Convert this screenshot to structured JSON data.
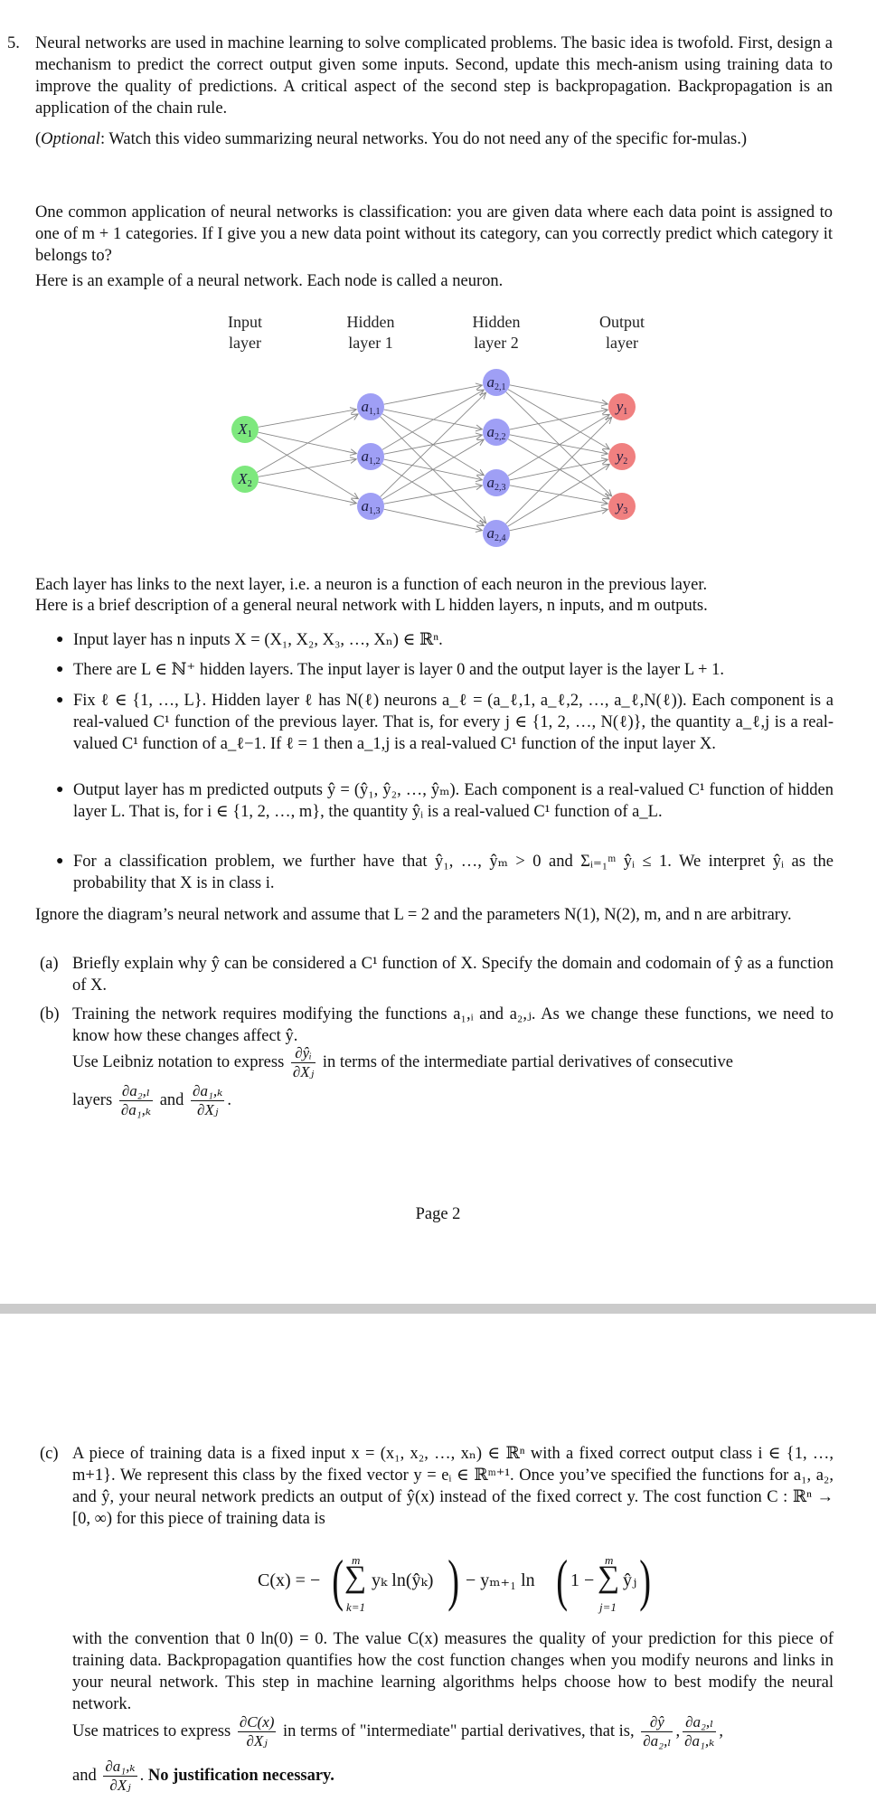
{
  "problem": {
    "number": "5.",
    "intro": "Neural networks are used in machine learning to solve complicated problems. The basic idea is twofold. First, design a mechanism to predict the correct output given some inputs. Second, update this mech-anism using training data to improve the quality of predictions. A critical aspect of the second step is backpropagation. Backpropagation is an application of the chain rule.",
    "optional_label": "Optional",
    "optional_text": ": Watch this video summarizing neural networks. You do not need any of the specific for-mulas.)",
    "classification_text": "One common application of neural networks is classification: you are given data where each data point is assigned to one of m + 1 categories. If I give you a new data point without its category, can you correctly predict which category it belongs to?",
    "example_text": "Here is an example of a neural network. Each node is called a neuron."
  },
  "diagram": {
    "layers": [
      {
        "title1": "Input",
        "title2": "layer",
        "nodes": [
          "X1",
          "X2"
        ],
        "color": "#7ee87e"
      },
      {
        "title1": "Hidden",
        "title2": "layer 1",
        "nodes": [
          "a1,1",
          "a1,2",
          "a1,3"
        ],
        "color": "#9f9ff5"
      },
      {
        "title1": "Hidden",
        "title2": "layer 2",
        "nodes": [
          "a2,1",
          "a2,2",
          "a2,3",
          "a2,4"
        ],
        "color": "#9f9ff5"
      },
      {
        "title1": "Output",
        "title2": "layer",
        "nodes": [
          "y1",
          "y2",
          "y3"
        ],
        "color": "#f08080"
      }
    ],
    "edge_color": "#888888"
  },
  "description": {
    "line1": "Each layer has links to the next layer, i.e. a neuron is a function of each neuron in the previous layer.",
    "line2": "Here is a brief description of a general neural network with L hidden layers, n inputs, and m outputs."
  },
  "bullets": [
    "Input layer has n inputs X = (X₁, X₂, X₃, …, Xₙ) ∈ ℝⁿ.",
    "There are L ∈ ℕ⁺ hidden layers. The input layer is layer 0 and the output layer is the layer L + 1.",
    "Fix ℓ ∈ {1, …, L}. Hidden layer ℓ has N(ℓ) neurons a_ℓ = (a_ℓ,1, a_ℓ,2, …, a_ℓ,N(ℓ)). Each component is a real-valued C¹ function of the previous layer. That is, for every j ∈ {1, 2, …, N(ℓ)}, the quantity a_ℓ,j is a real-valued C¹ function of a_ℓ−1. If ℓ = 1 then a_1,j is a real-valued C¹ function of the input layer X.",
    "Output layer has m predicted outputs ŷ = (ŷ₁, ŷ₂, …, ŷₘ). Each component is a real-valued C¹ function of hidden layer L. That is, for i ∈ {1, 2, …, m}, the quantity ŷᵢ is a real-valued C¹ function of a_L.",
    "For a classification problem, we further have that ŷ₁, …, ŷₘ > 0 and Σᵢ₌₁ᵐ ŷᵢ ≤ 1. We interpret ŷᵢ as the probability that X is in class i."
  ],
  "assumption": "Ignore the diagram’s neural network and assume that L = 2 and the parameters N(1), N(2), m, and n are arbitrary.",
  "parts": {
    "a": {
      "label": "(a)",
      "text": "Briefly explain why ŷ can be considered a C¹ function of X. Specify the domain and codomain of ŷ as a function of X."
    },
    "b": {
      "label": "(b)",
      "text1": "Training the network requires modifying the functions a₁,ᵢ and a₂,ⱼ. As we change these functions, we need to know how these changes affect ŷ.",
      "text2_pre": "Use Leibniz notation to express",
      "text2_post": "in terms of the intermediate partial derivatives of consecutive",
      "text3_pre": "layers",
      "text3_mid": "and",
      "frac_main_num": "∂ŷᵢ",
      "frac_main_den": "∂Xⱼ",
      "frac1_num": "∂a₂,ₗ",
      "frac1_den": "∂a₁,ₖ",
      "frac2_num": "∂a₁,ₖ",
      "frac2_den": "∂Xⱼ"
    },
    "c": {
      "label": "(c)",
      "text1": "A piece of training data is a fixed input x = (x₁, x₂, …, xₙ) ∈ ℝⁿ with a fixed correct output class i ∈ {1, …, m+1}. We represent this class by the fixed vector y = eᵢ ∈ ℝᵐ⁺¹. Once you’ve specified the functions for a₁, a₂, and ŷ, your neural network predicts an output of ŷ(x) instead of the fixed correct y. The cost function C : ℝⁿ → [0, ∞) for this piece of training data is",
      "formula": {
        "lhs": "C(x) = −",
        "sum1_top": "m",
        "sum1_bottom": "k=1",
        "term1": "yₖ ln(ŷₖ)",
        "minus": "− yₘ₊₁ ln",
        "one_minus": "1 −",
        "sum2_top": "m",
        "sum2_bottom": "j=1",
        "term2": "ŷⱼ"
      },
      "text2": "with the convention that 0 ln(0) = 0. The value C(x) measures the quality of your prediction for this piece of training data. Backpropagation quantifies how the cost function changes when you modify neurons and links in your neural network. This step in machine learning algorithms helps choose how to best modify the neural network.",
      "text3_pre": "Use matrices to express",
      "text3_mid": "in terms of \"intermediate\" partial derivatives, that is,",
      "text4_pre": "and",
      "bold_text": "No justification necessary.",
      "frac_c_num": "∂C(x)",
      "frac_c_den": "∂Xⱼ",
      "frac_y_num": "∂ŷ",
      "frac_y_den": "∂a₂,ₗ",
      "frac_a2_num": "∂a₂,ₗ",
      "frac_a2_den": "∂a₁,ₖ",
      "frac_a1_num": "∂a₁,ₖ",
      "frac_a1_den": "∂Xⱼ"
    }
  },
  "footer": {
    "page_label": "Page 2"
  }
}
